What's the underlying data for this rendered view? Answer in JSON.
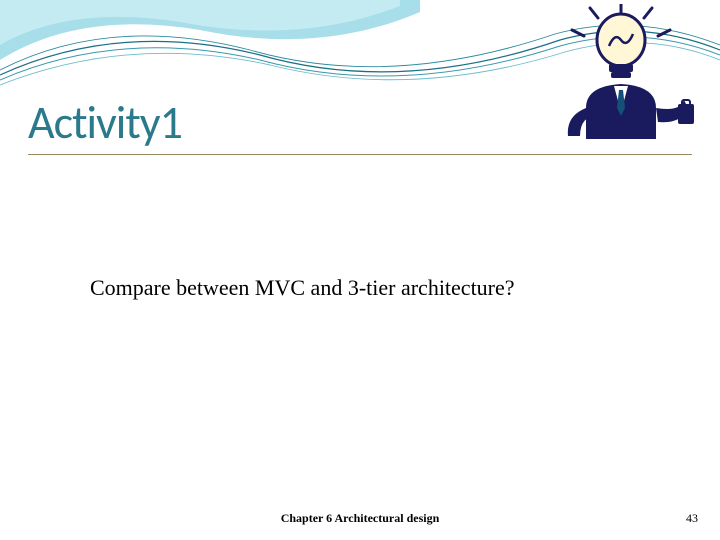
{
  "title": "Activity1",
  "body": "Compare between MVC and 3-tier architecture?",
  "footer": {
    "chapter": "Chapter 6 Architectural design",
    "page": "43"
  },
  "clipart": {
    "name": "idea-person-icon"
  },
  "decor": {
    "name": "wave-swoosh"
  },
  "colors": {
    "title": "#2a7a8c",
    "underline": "#9b8860",
    "wave_fill": "#8fd5e3",
    "wave_dark": "#1c6f85"
  }
}
